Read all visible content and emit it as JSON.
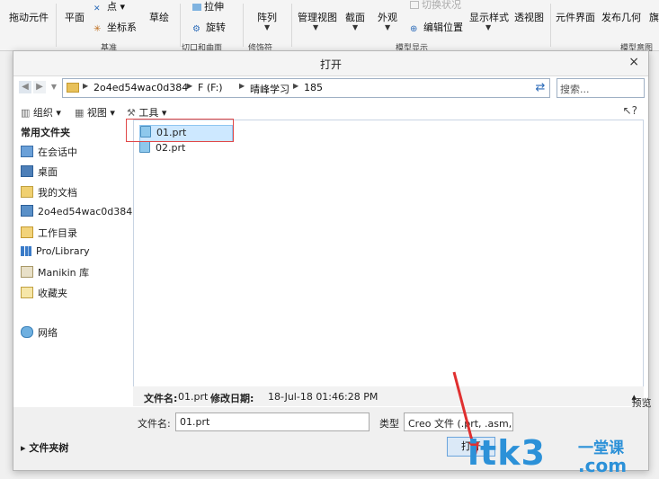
{
  "ribbon": {
    "items": [
      "拖动元件",
      "平面",
      "点",
      "坐标系",
      "草绘",
      "拉伸",
      "旋转",
      "阵列",
      "管理视图",
      "截面",
      "外观",
      "切换状况",
      "编辑位置",
      "显示样式",
      "透视图",
      "元件界面",
      "发布几何",
      "旗"
    ],
    "groups": [
      "基准",
      "切口和曲面",
      "修饰符",
      "模型显示",
      "模型意图"
    ]
  },
  "dialog": {
    "title": "打开",
    "close": "×",
    "address": [
      "2o4ed54wac0d384",
      "F (F:)",
      "晴峰学习",
      "185"
    ],
    "search_placeholder": "搜索...",
    "toolbar": {
      "organize": "组织",
      "view": "视图",
      "tools": "工具",
      "help": "?"
    },
    "nav": {
      "header": "常用文件夹",
      "items": [
        "在会话中",
        "桌面",
        "我的文档",
        "2o4ed54wac0d384",
        "工作目录",
        "Pro/Library",
        "Manikin 库",
        "收藏夹",
        "网络"
      ]
    },
    "files": [
      "01.prt",
      "02.prt"
    ],
    "details": {
      "name_label": "文件名:",
      "name_value": "01.prt",
      "date_label": "修改日期:",
      "date_value": "18-Jul-18 01:46:28 PM",
      "preview": "预览"
    },
    "bottom": {
      "filename_label": "文件名:",
      "filename_value": "01.prt",
      "type_label": "类型",
      "type_value": "Creo 文件 (.prt, .asm,",
      "open_button": "打开",
      "folder_tree": "文件夹树"
    }
  },
  "watermark": {
    "main": "itk3",
    "line1": "一堂课",
    "line2": ".com"
  },
  "colors": {
    "accent": "#2c91d8",
    "selection": "#cde8ff",
    "highlight_box": "#e04848",
    "arrow": "#e03030"
  }
}
